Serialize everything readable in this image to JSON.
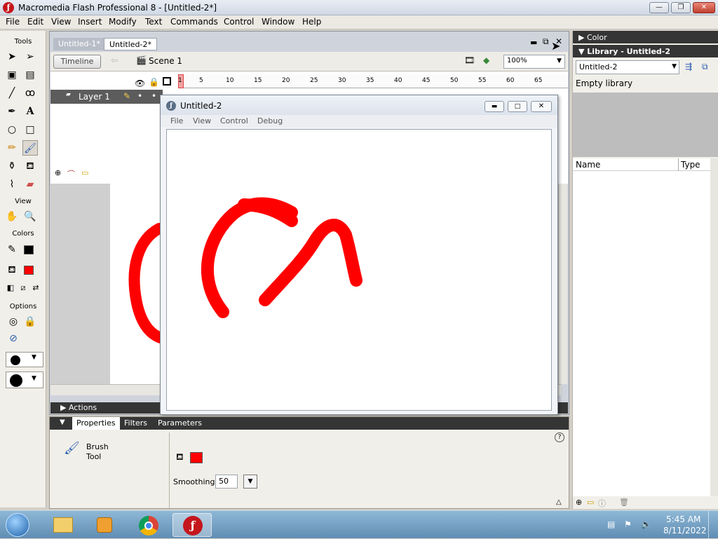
{
  "window": {
    "title": "Macromedia Flash Professional 8 - [Untitled-2*]"
  },
  "menu": [
    "File",
    "Edit",
    "View",
    "Insert",
    "Modify",
    "Text",
    "Commands",
    "Control",
    "Window",
    "Help"
  ],
  "tools": {
    "header": "Tools",
    "view_label": "View",
    "colors_label": "Colors",
    "options_label": "Options",
    "stroke_color": "#000000",
    "fill_color": "#ff0000"
  },
  "document": {
    "tabs": [
      "Untitled-1*",
      "Untitled-2*"
    ],
    "timeline_button": "Timeline",
    "scene": "Scene 1",
    "zoom": "100%",
    "frame_numbers": [
      "1",
      "5",
      "10",
      "15",
      "20",
      "25",
      "30",
      "35",
      "40",
      "45",
      "50",
      "55",
      "60",
      "65"
    ],
    "layer": "Layer 1"
  },
  "player": {
    "title": "Untitled-2",
    "menu": [
      "File",
      "View",
      "Control",
      "Debug"
    ]
  },
  "actions_label": "Actions",
  "properties": {
    "tabs": [
      "Properties",
      "Filters",
      "Parameters"
    ],
    "tool_name_line1": "Brush",
    "tool_name_line2": "Tool",
    "smoothing_label": "Smoothing",
    "smoothing_value": "50",
    "fill_color": "#ff0000"
  },
  "panels": {
    "color_label": "Color",
    "library_label": "Library - Untitled-2",
    "library_select": "Untitled-2",
    "empty_text": "Empty library",
    "col_name": "Name",
    "col_type": "Type"
  },
  "taskbar": {
    "time": "5:45 AM",
    "date": "8/11/2022"
  },
  "colors": {
    "stroke_red": "#ff0000",
    "panel_dark": "#353535"
  }
}
